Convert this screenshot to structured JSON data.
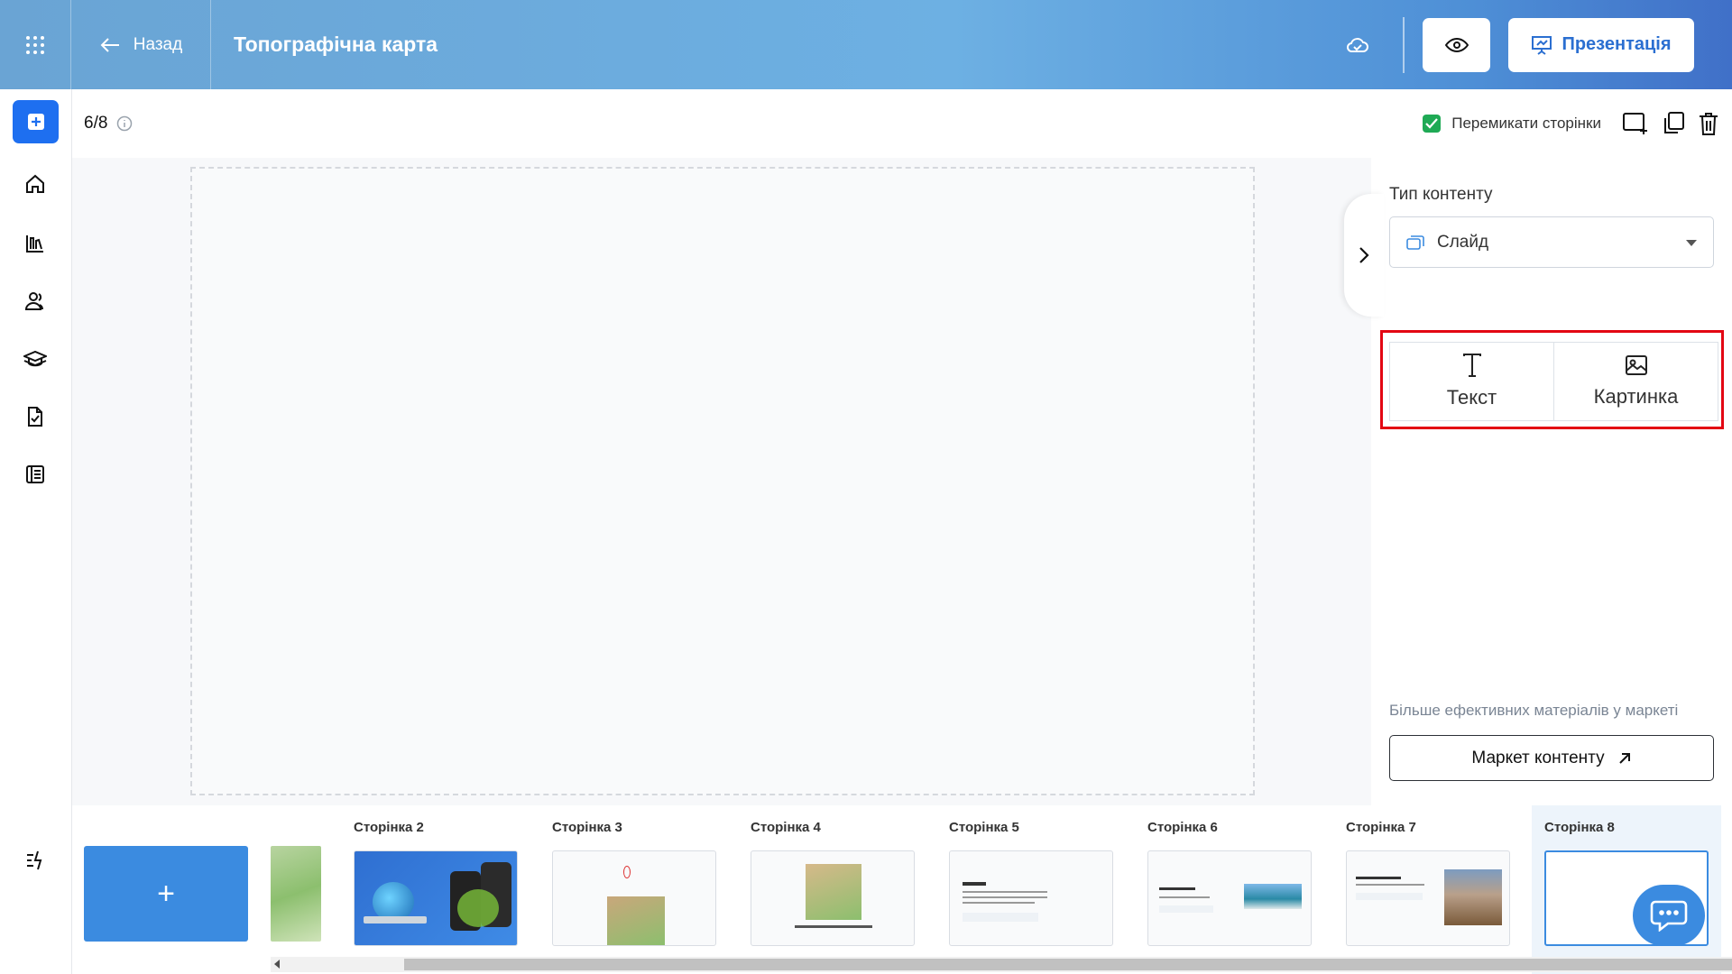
{
  "header": {
    "back_label": "Назад",
    "title": "Топографічна карта",
    "present_label": "Презентація",
    "icons": [
      "apps-grid-icon",
      "arrow-left-icon",
      "cloud-saved-icon",
      "eye-icon",
      "presentation-icon"
    ]
  },
  "leftnav": {
    "items": [
      "add-icon",
      "home-icon",
      "library-icon",
      "users-icon",
      "graduation-cap-icon",
      "checklist-icon",
      "journal-icon",
      "quick-actions-icon"
    ]
  },
  "toolbar": {
    "page_counter": "6/8",
    "switch_pages_label": "Перемикати сторінки",
    "switch_pages_checked": true
  },
  "panel": {
    "content_type_label": "Тип контенту",
    "content_type_value": "Слайд",
    "elements": [
      {
        "label": "Текст",
        "icon": "text-icon"
      },
      {
        "label": "Картинка",
        "icon": "image-icon"
      }
    ],
    "market_note": "Більше ефективних матеріалів у маркеті",
    "market_button": "Маркет контенту"
  },
  "thumbnails": {
    "add_label": "+",
    "pages": [
      {
        "label": "Сторінка 2"
      },
      {
        "label": "Сторінка 3"
      },
      {
        "label": "Сторінка 4"
      },
      {
        "label": "Сторінка 5"
      },
      {
        "label": "Сторінка 6"
      },
      {
        "label": "Сторінка 7"
      },
      {
        "label": "Сторінка 8",
        "active": true
      }
    ]
  },
  "colors": {
    "accent": "#1e6ff0",
    "highlight": "#e30613",
    "check": "#1faa55"
  }
}
